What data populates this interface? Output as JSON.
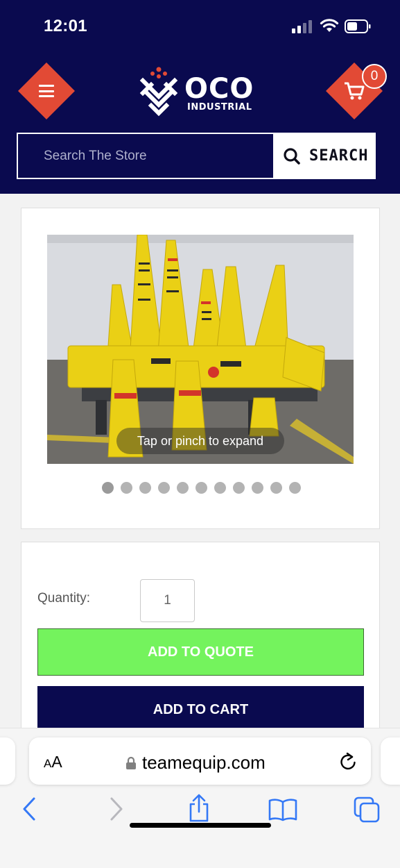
{
  "status_bar": {
    "time": "12:01"
  },
  "header": {
    "logo_text": "OCO",
    "logo_sub": "INDUSTRIAL",
    "cart_count": "0",
    "search_placeholder": "Search The Store",
    "search_button": "SEARCH"
  },
  "gallery": {
    "hint": "Tap or pinch to expand",
    "dot_count": 11,
    "active_index": 0
  },
  "purchase": {
    "quantity_label": "Quantity:",
    "quantity_value": "1",
    "quote_button": "ADD TO QUOTE",
    "cart_button": "ADD TO CART"
  },
  "browser": {
    "aa_label": "AA",
    "url": "teamequip.com"
  },
  "colors": {
    "navy": "#0a0a4f",
    "brand_red": "#e24a35",
    "quote_green": "#74f35d"
  }
}
